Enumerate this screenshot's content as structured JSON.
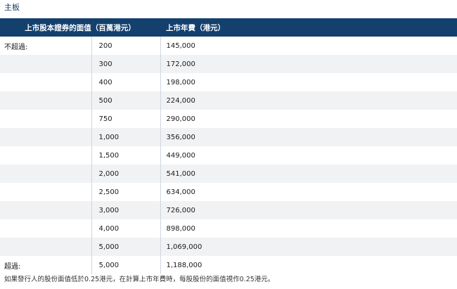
{
  "section_title": "主板",
  "table": {
    "headers": {
      "value": "上市股本證券的面值（百萬港元）",
      "fee": "上市年費（港元）"
    },
    "rows": [
      {
        "condition": "不超過:",
        "value": "200",
        "fee": "145,000"
      },
      {
        "condition": "",
        "value": "300",
        "fee": "172,000"
      },
      {
        "condition": "",
        "value": "400",
        "fee": "198,000"
      },
      {
        "condition": "",
        "value": "500",
        "fee": "224,000"
      },
      {
        "condition": "",
        "value": "750",
        "fee": "290,000"
      },
      {
        "condition": "",
        "value": "1,000",
        "fee": "356,000"
      },
      {
        "condition": "",
        "value": "1,500",
        "fee": "449,000"
      },
      {
        "condition": "",
        "value": "2,000",
        "fee": "541,000"
      },
      {
        "condition": "",
        "value": "2,500",
        "fee": "634,000"
      },
      {
        "condition": "",
        "value": "3,000",
        "fee": "726,000"
      },
      {
        "condition": "",
        "value": "4,000",
        "fee": "898,000"
      },
      {
        "condition": "",
        "value": "5,000",
        "fee": "1,069,000"
      },
      {
        "condition": "超過:",
        "value": "5,000",
        "fee": "1,188,000"
      }
    ]
  },
  "footnote": "如果發行人的股份面值低於0.25港元，在計算上市年費時，每股股份的面值視作0.25港元。",
  "colors": {
    "header_bg": "#14406e",
    "header_text": "#ffffff",
    "row_alt_bg": "#f1f2f4",
    "title_text": "#1a3a66"
  }
}
